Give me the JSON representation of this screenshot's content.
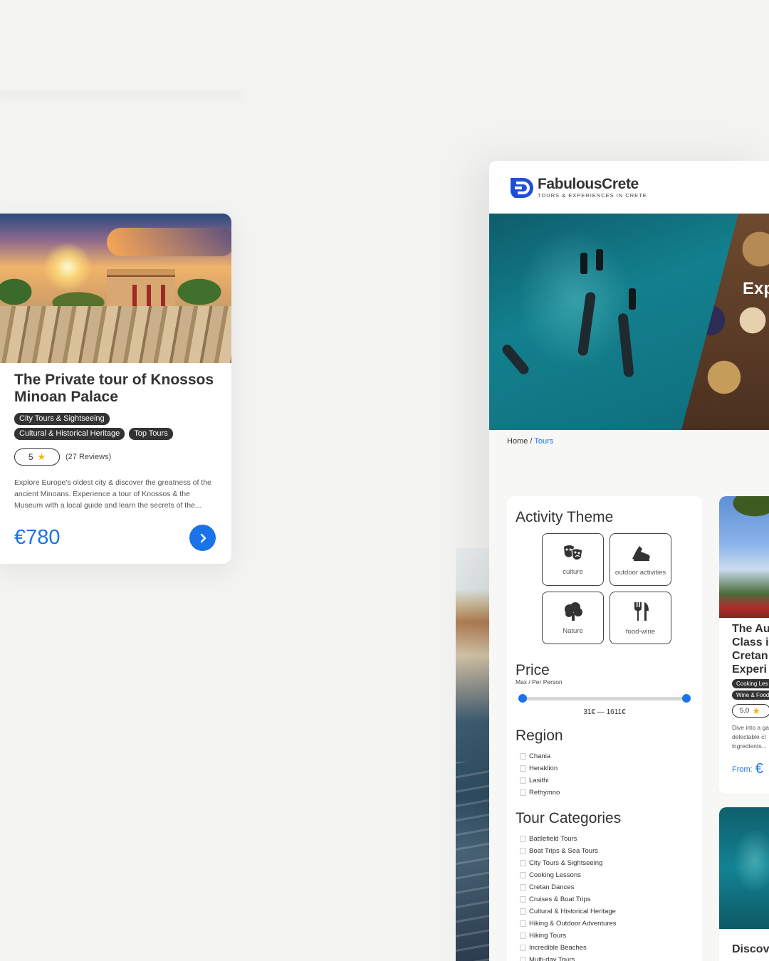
{
  "tour_card": {
    "title": "The Private tour of Knossos Minoan Palace",
    "tags": [
      "City Tours & Sightseeing",
      "Cultural & Historical Heritage",
      "Top Tours"
    ],
    "rating": "5",
    "reviews": "(27 Reviews)",
    "description": "Explore Europe's oldest city & discover the greatness of the ancient Minoans. Experience a tour of Knossos & the Museum with a local guide and learn the secrets of the...",
    "price": "€780",
    "image_icon": "knossos-palace-photo",
    "button_icon": "chevron-right-icon"
  },
  "site": {
    "brand_name": "FabulousCrete",
    "brand_tagline": "TOURS & EXPERIENCES IN CRETE",
    "hero_word": "Exp",
    "breadcrumb": {
      "home": "Home",
      "separator": " / ",
      "current": "Tours"
    }
  },
  "filters": {
    "activity_title": "Activity Theme",
    "themes": [
      {
        "label": "culture",
        "icon": "theater-masks-icon"
      },
      {
        "label": "outdoor activities",
        "icon": "running-shoe-icon"
      },
      {
        "label": "Nature",
        "icon": "tree-icon"
      },
      {
        "label": "food-wine",
        "icon": "fork-knife-icon"
      }
    ],
    "price_title": "Price",
    "price_subtitle": "Max / Per Person",
    "price_range": "31€ — 1611€",
    "price_min_fraction": 0.0,
    "price_max_fraction": 1.0,
    "region_title": "Region",
    "regions": [
      "Chania",
      "Heraklion",
      "Lasithi",
      "Rethymno"
    ],
    "categories_title": "Tour Categories",
    "categories": [
      "Battlefield Tours",
      "Boat Trips & Sea Tours",
      "City Tours & Sightseeing",
      "Cooking Lessons",
      "Cretan Dances",
      "Cruises & Boat Trips",
      "Cultural & Historical Heritage",
      "Hiking & Outdoor Adventures",
      "Hiking Tours",
      "Incredible Beaches",
      "Multi-day Tours"
    ]
  },
  "peek_card": {
    "title_lines": [
      "The Au",
      "Class i",
      "Cretan",
      "Experi"
    ],
    "tags": [
      "Cooking Les",
      "Wine & Food"
    ],
    "rating": "5.0",
    "desc_lines": [
      "Dive into a ga",
      "delectable cl",
      "ingredients..."
    ],
    "from_label": "From:",
    "price_partial": "€"
  },
  "peek_card2": {
    "title": "Discov"
  },
  "colors": {
    "accent": "#1a73e8",
    "tag_bg": "#333333",
    "star": "#f4b400"
  }
}
